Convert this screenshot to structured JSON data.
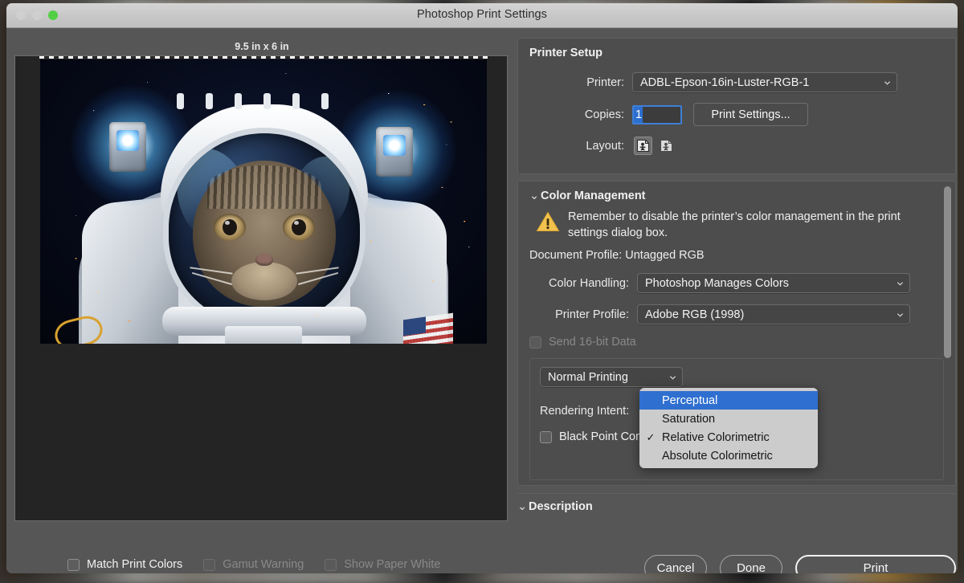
{
  "window": {
    "title": "Photoshop Print Settings",
    "traffic_lights": [
      "close-button",
      "minimize-button",
      "maximize-button"
    ],
    "accent_green": "#53cf45"
  },
  "preview": {
    "dimensions_label": "9.5 in x 6 in",
    "image_description": "astronaut cat in space suit with helmet",
    "checkboxes": [
      {
        "label": "Match Print Colors",
        "checked": false,
        "disabled": false
      },
      {
        "label": "Gamut Warning",
        "checked": false,
        "disabled": true
      },
      {
        "label": "Show Paper White",
        "checked": false,
        "disabled": true
      }
    ]
  },
  "printer_setup": {
    "title": "Printer Setup",
    "printer_label": "Printer:",
    "printer_value": "ADBL-Epson-16in-Luster-RGB-1",
    "copies_label": "Copies:",
    "copies_value": "1",
    "print_settings_button": "Print Settings...",
    "layout_label": "Layout:",
    "layout_options": [
      "portrait-layout-icon",
      "landscape-layout-icon"
    ],
    "layout_selected_index": 0
  },
  "color_management": {
    "title": "Color Management",
    "warning_icon": "warning-triangle-icon",
    "warning_color": "#f2c14e",
    "warning_text": "Remember to disable the printer’s color management in the print settings dialog box.",
    "document_profile": "Document Profile: Untagged RGB",
    "color_handling_label": "Color Handling:",
    "color_handling_value": "Photoshop Manages Colors",
    "printer_profile_label": "Printer Profile:",
    "printer_profile_value": "Adobe RGB (1998)",
    "send_16bit_label": "Send 16-bit Data",
    "send_16bit_checked": false,
    "send_16bit_disabled": true,
    "normal_printing_value": "Normal Printing",
    "rendering_intent_label": "Rendering Intent:",
    "black_point_label": "Black Point Compensation",
    "black_point_checked": false,
    "scrollbar": "vertical-scrollbar"
  },
  "rendering_intent_menu": {
    "highlight_color": "#2f6fd0",
    "background_color": "#cccccc",
    "items": [
      {
        "label": "Perceptual",
        "checked": false,
        "highlighted": true
      },
      {
        "label": "Saturation",
        "checked": false,
        "highlighted": false
      },
      {
        "label": "Relative Colorimetric",
        "checked": true,
        "highlighted": false
      },
      {
        "label": "Absolute Colorimetric",
        "checked": false,
        "highlighted": false
      }
    ]
  },
  "description": {
    "title": "Description"
  },
  "actions": {
    "cancel": "Cancel",
    "done": "Done",
    "print": "Print"
  },
  "icons": {
    "chevron_down": "chevron-down-icon",
    "chevron_collapse": "⌄",
    "checkmark": "✓"
  }
}
